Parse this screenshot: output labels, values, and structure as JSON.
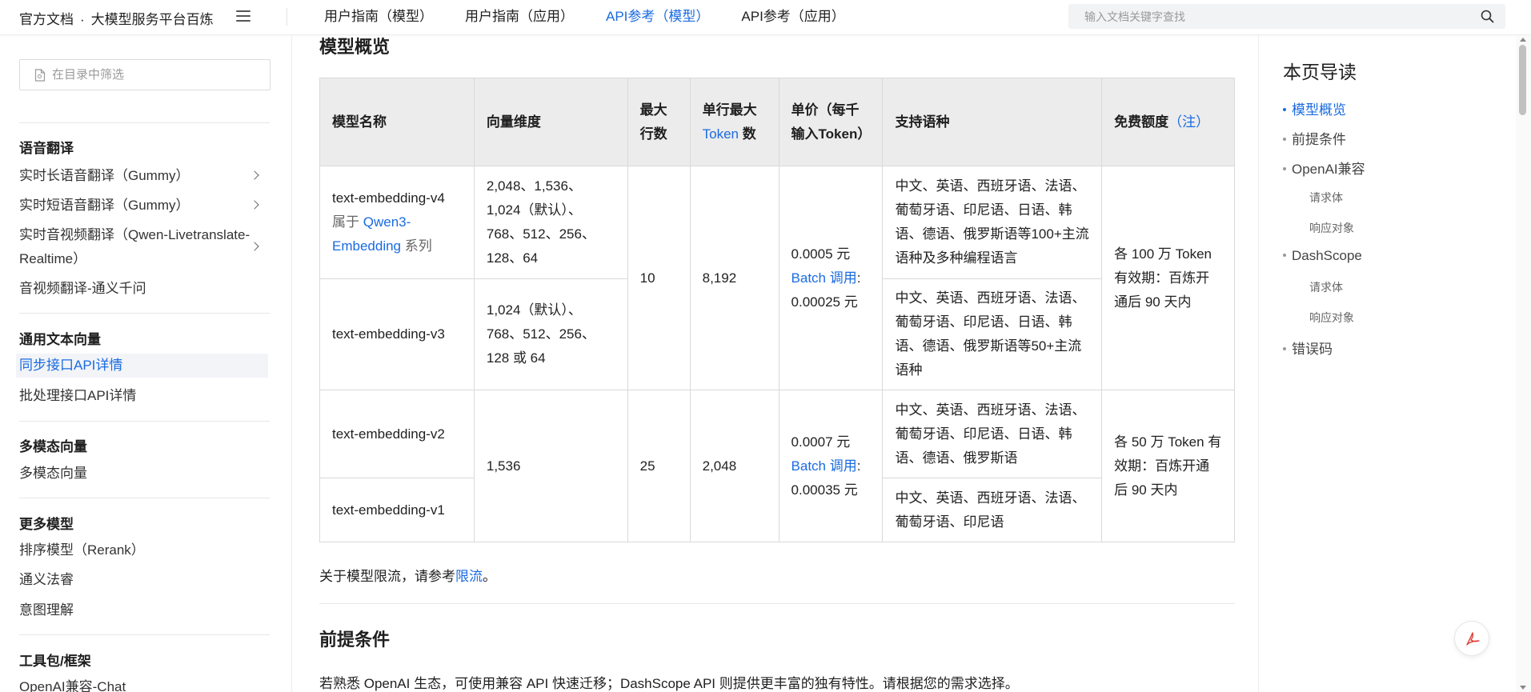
{
  "header": {
    "brand": "官方文档",
    "brand_separator": "·",
    "product": "大模型服务平台百炼",
    "nav": [
      "用户指南（模型）",
      "用户指南（应用）",
      "API参考（模型）",
      "API参考（应用）"
    ],
    "active_nav": "API参考（模型）",
    "search_placeholder": "输入文档关键字查找",
    "accent_color": "#1a6be0"
  },
  "sidebar": {
    "filter_placeholder": "在目录中筛选",
    "groups": [
      {
        "title": "语音翻译",
        "items": [
          "实时长语音翻译（Gummy）",
          "实时短语音翻译（Gummy）",
          "实时音视频翻译（Qwen-Livetranslate-Realtime）",
          "音视频翻译-通义千问"
        ]
      },
      {
        "title": "通用文本向量",
        "items": [
          "同步接口API详情",
          "批处理接口API详情"
        ]
      },
      {
        "title": "多模态向量",
        "items": [
          "多模态向量"
        ]
      },
      {
        "title": "更多模型",
        "items": [
          "排序模型（Rerank）",
          "通义法睿",
          "意图理解"
        ]
      },
      {
        "title": "工具包/框架",
        "items": [
          "OpenAI兼容-Chat"
        ]
      }
    ],
    "active_item": "同步接口API详情"
  },
  "main": {
    "section_overview_title": "模型概览",
    "table": {
      "headers": {
        "name": "模型名称",
        "dims": "向量维度",
        "max_rows": "最大行数",
        "max_tokens_prefix": "单行最大",
        "max_tokens_link": "Token",
        "max_tokens_suffix": "数",
        "price": "单价（每千输入Token）",
        "languages": "支持语种",
        "free_quota": "免费额度",
        "free_quota_note": "（注）"
      },
      "rows": [
        {
          "name": "text-embedding-v4",
          "belongs_prefix": "属于",
          "belongs_link": "Qwen3-Embedding",
          "belongs_suffix": "系列",
          "dims": "2,048、1,536、1,024（默认）、768、512、256、128、64",
          "languages": "中文、英语、西班牙语、法语、葡萄牙语、印尼语、日语、韩语、德语、俄罗斯语等100+主流语种及多种编程语言"
        },
        {
          "name": "text-embedding-v3",
          "dims": "1,024（默认）、768、512、256、128 或 64",
          "languages": "中文、英语、西班牙语、法语、葡萄牙语、印尼语、日语、韩语、德语、俄罗斯语等50+主流语种"
        },
        {
          "name": "text-embedding-v2",
          "languages": "中文、英语、西班牙语、法语、葡萄牙语、印尼语、日语、韩语、德语、俄罗斯语"
        },
        {
          "name": "text-embedding-v1",
          "languages": "中文、英语、西班牙语、法语、葡萄牙语、印尼语"
        }
      ],
      "group_a": {
        "max_rows": "10",
        "max_tokens": "8,192",
        "price": "0.0005 元",
        "batch_link": "Batch 调用",
        "batch_price": "0.00025 元",
        "free_quota": "各 100 万 Token 有效期：百炼开通后 90 天内"
      },
      "group_b": {
        "dims": "1,536",
        "max_rows": "25",
        "max_tokens": "2,048",
        "price": "0.0007 元",
        "batch_link": "Batch 调用",
        "batch_price": "0.00035 元",
        "free_quota": "各 50 万 Token 有效期：百炼开通后 90 天内"
      }
    },
    "rate_limit_prefix": "关于模型限流，请参考",
    "rate_limit_link": "限流",
    "rate_limit_suffix": "。",
    "section_prereq_title": "前提条件",
    "prereq_text": "若熟悉 OpenAI 生态，可使用兼容 API 快速迁移；DashScope API 则提供更丰富的独有特性。请根据您的需求选择。"
  },
  "toc": {
    "title": "本页导读",
    "items": [
      {
        "label": "模型概览",
        "level": 1,
        "active": true
      },
      {
        "label": "前提条件",
        "level": 1
      },
      {
        "label": "OpenAI兼容",
        "level": 1
      },
      {
        "label": "请求体",
        "level": 2
      },
      {
        "label": "响应对象",
        "level": 2
      },
      {
        "label": "DashScope",
        "level": 1
      },
      {
        "label": "请求体",
        "level": 2
      },
      {
        "label": "响应对象",
        "level": 2
      },
      {
        "label": "错误码",
        "level": 1
      }
    ]
  },
  "icons": [
    "menu-icon",
    "search-icon",
    "document-icon",
    "chevron-right-icon",
    "pdf-icon"
  ]
}
